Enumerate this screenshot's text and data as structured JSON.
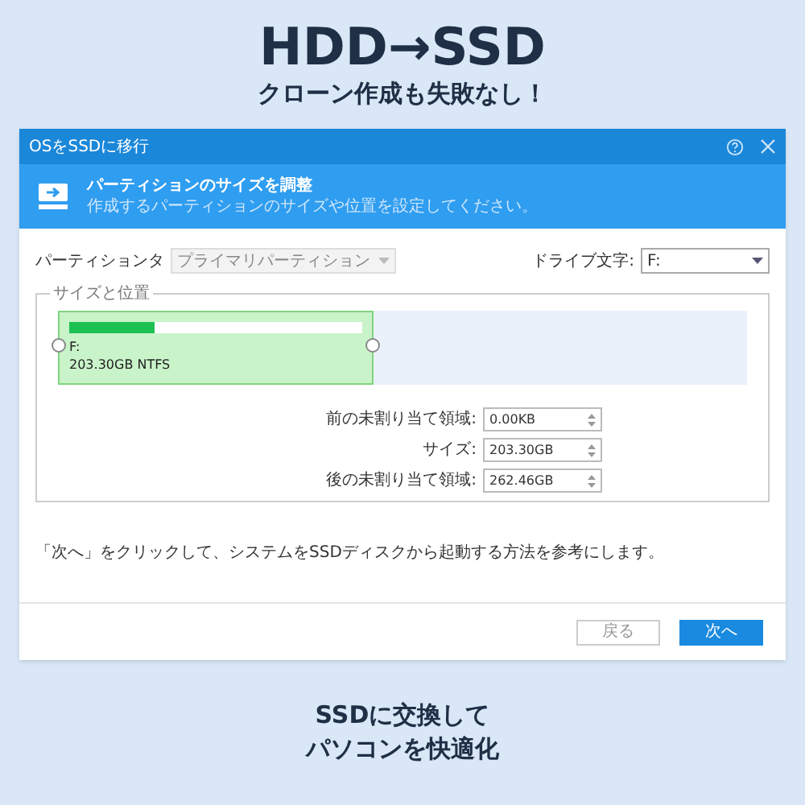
{
  "headline": "HDD→SSD",
  "subheadline": "クローン作成も失敗なし！",
  "window": {
    "title": "OSをSSDに移行",
    "banner": {
      "title": "パーティションのサイズを調整",
      "subtitle": "作成するパーティションのサイズや位置を設定してください。"
    },
    "partition_type": {
      "label": "パーティションタ",
      "value": "プライマリパーティション",
      "disabled": true
    },
    "drive_letter": {
      "label": "ドライブ文字:",
      "value": "F:",
      "disabled": false
    },
    "group_title": "サイズと位置",
    "partition": {
      "letter": "F:",
      "info": "203.30GB NTFS",
      "level": 0.29
    },
    "fields": [
      {
        "label": "前の未割り当て領域:",
        "value": "0.00KB"
      },
      {
        "label": "サイズ:",
        "value": "203.30GB"
      },
      {
        "label": "後の未割り当て領域:",
        "value": "262.46GB"
      }
    ],
    "note": "「次へ」をクリックして、システムをSSDディスクから起動する方法を参考にします。",
    "buttons": [
      {
        "label": "戻る",
        "kind": "default",
        "disabled": true
      },
      {
        "label": "次へ",
        "kind": "primary",
        "disabled": false
      }
    ]
  },
  "footer_lines": [
    "SSDに交換して",
    "パソコンを快適化"
  ]
}
